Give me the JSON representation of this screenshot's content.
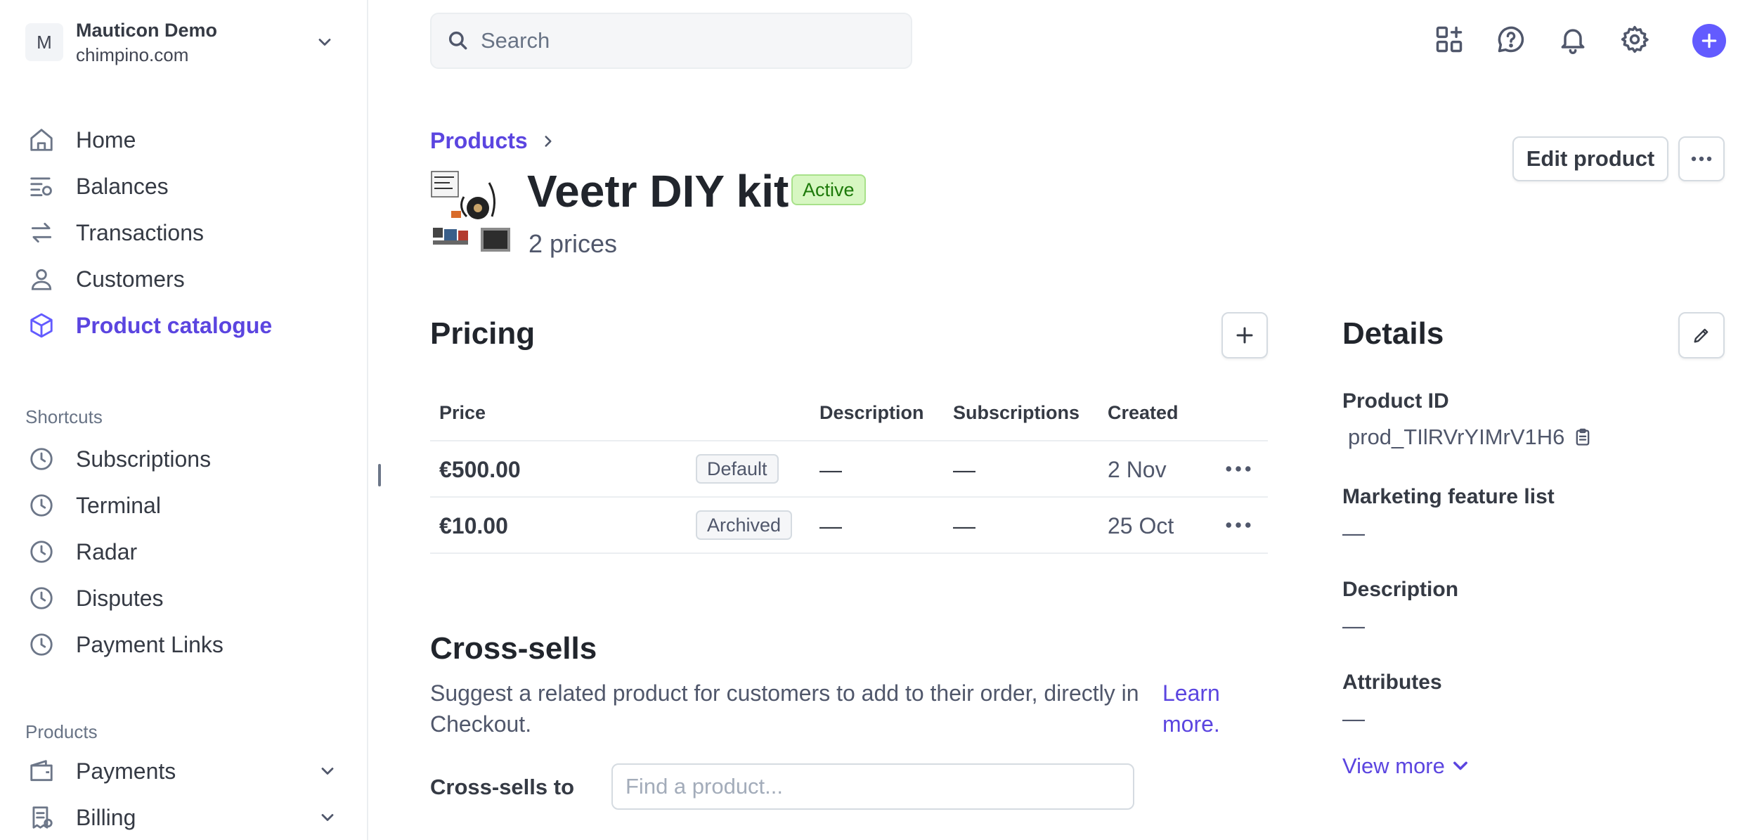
{
  "account": {
    "initial": "M",
    "name": "Mauticon Demo",
    "domain": "chimpino.com"
  },
  "nav": [
    {
      "label": "Home",
      "icon": "home-icon"
    },
    {
      "label": "Balances",
      "icon": "balances-icon"
    },
    {
      "label": "Transactions",
      "icon": "transactions-icon"
    },
    {
      "label": "Customers",
      "icon": "person-icon"
    },
    {
      "label": "Product catalogue",
      "icon": "cube-icon",
      "active": true
    }
  ],
  "shortcuts": {
    "label": "Shortcuts",
    "items": [
      "Subscriptions",
      "Terminal",
      "Radar",
      "Disputes",
      "Payment Links"
    ]
  },
  "products_section": {
    "label": "Products",
    "items": [
      "Payments",
      "Billing"
    ]
  },
  "search": {
    "placeholder": "Search"
  },
  "breadcrumb": {
    "parent": "Products"
  },
  "product": {
    "title": "Veetr DIY kit",
    "status": "Active",
    "price_count": "2 prices"
  },
  "actions": {
    "edit_label": "Edit product"
  },
  "pricing": {
    "title": "Pricing",
    "columns": [
      "Price",
      "Description",
      "Subscriptions",
      "Created"
    ],
    "rows": [
      {
        "price": "€500.00",
        "tag": "Default",
        "description": "—",
        "subscriptions": "—",
        "created": "2 Nov"
      },
      {
        "price": "€10.00",
        "tag": "Archived",
        "description": "—",
        "subscriptions": "—",
        "created": "25 Oct"
      }
    ]
  },
  "cross_sells": {
    "title": "Cross-sells",
    "description": "Suggest a related product for customers to add to their order, directly in Checkout.",
    "learn_more": "Learn more.",
    "field_label": "Cross-sells to",
    "placeholder": "Find a product..."
  },
  "details": {
    "title": "Details",
    "product_id_label": "Product ID",
    "product_id": "prod_TIlRVrYIMrV1H6",
    "marketing_label": "Marketing feature list",
    "marketing_value": "—",
    "description_label": "Description",
    "description_value": "—",
    "attributes_label": "Attributes",
    "attributes_value": "—",
    "view_more": "View more"
  },
  "colors": {
    "accent": "#635bff",
    "link": "#5b45e0",
    "active_badge_bg": "#d7f7c2",
    "active_badge_text": "#1d7a0a"
  }
}
